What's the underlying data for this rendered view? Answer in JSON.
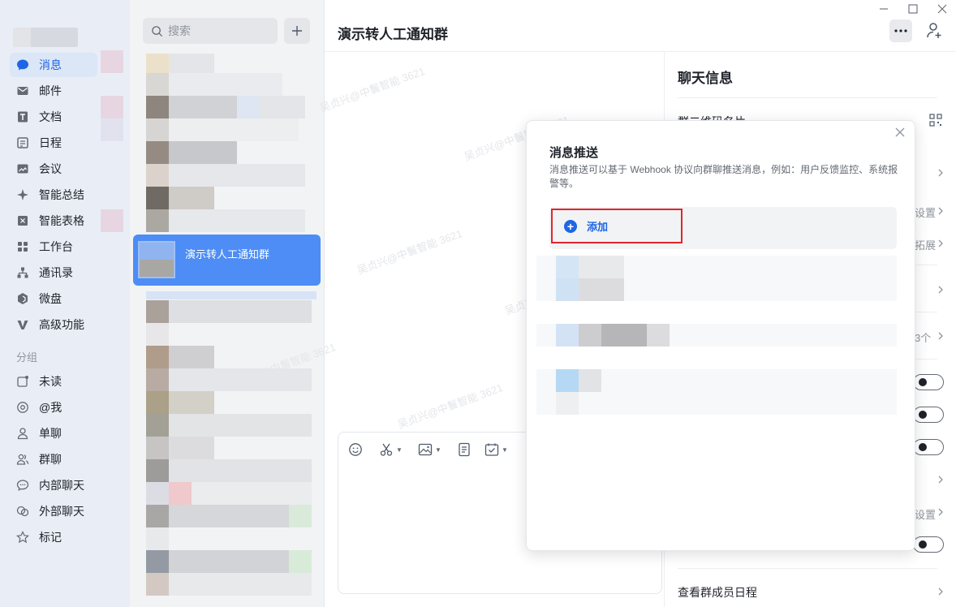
{
  "nav": {
    "items": [
      {
        "label": "消息",
        "icon": "chat-bubble-icon",
        "active": true
      },
      {
        "label": "邮件",
        "icon": "mail-icon"
      },
      {
        "label": "文档",
        "icon": "document-icon"
      },
      {
        "label": "日程",
        "icon": "calendar-icon"
      },
      {
        "label": "会议",
        "icon": "meeting-icon"
      },
      {
        "label": "智能总结",
        "icon": "sparkle-icon"
      },
      {
        "label": "智能表格",
        "icon": "smart-sheet-icon"
      },
      {
        "label": "工作台",
        "icon": "workbench-icon"
      },
      {
        "label": "通讯录",
        "icon": "contacts-icon"
      },
      {
        "label": "微盘",
        "icon": "cloud-drive-icon"
      },
      {
        "label": "高级功能",
        "icon": "advanced-icon"
      }
    ],
    "section_label": "分组",
    "groups": [
      {
        "label": "未读",
        "icon": "unread-icon"
      },
      {
        "label": "@我",
        "icon": "at-icon"
      },
      {
        "label": "单聊",
        "icon": "single-chat-icon"
      },
      {
        "label": "群聊",
        "icon": "group-chat-icon"
      },
      {
        "label": "内部聊天",
        "icon": "internal-chat-icon"
      },
      {
        "label": "外部聊天",
        "icon": "external-chat-icon"
      },
      {
        "label": "标记",
        "icon": "star-icon"
      }
    ]
  },
  "list": {
    "search_placeholder": "搜索",
    "active_conversation": "演示转人工通知群"
  },
  "chat": {
    "title": "演示转人工通知群",
    "watermark": "吴贞兴@中鬟智能 3621"
  },
  "info": {
    "title": "聊天信息",
    "qr_row_label": "群二维码名片",
    "partial_labels": {
      "set1": "设置",
      "expand": "拓展",
      "count": "3个",
      "set2": "设置"
    },
    "bottom_row_label": "查看群成员日程"
  },
  "modal": {
    "title": "消息推送",
    "description": "消息推送可以基于 Webhook 协议向群聊推送消息，例如：用户反馈监控、系统报警等。",
    "add_label": "添加"
  },
  "colors": {
    "accent": "#1e66e5",
    "active_conversation": "#4d8df5",
    "highlight_border": "#e0262b"
  }
}
